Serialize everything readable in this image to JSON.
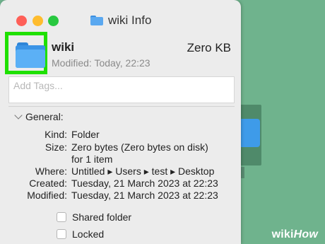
{
  "window": {
    "title": "wiki Info"
  },
  "header": {
    "name": "wiki",
    "size": "Zero KB",
    "modified": "Modified: Today, 22:23"
  },
  "tags": {
    "placeholder": "Add Tags..."
  },
  "general": {
    "heading": "General:",
    "rows": [
      {
        "label": "Kind:",
        "value": "Folder"
      },
      {
        "label": "Size:",
        "value": "Zero bytes (Zero bytes on disk)"
      },
      {
        "label": "",
        "value": "for 1 item"
      },
      {
        "label": "Where:",
        "value": "Untitled ▸ Users ▸ test ▸ Desktop"
      },
      {
        "label": "Created:",
        "value": "Tuesday, 21 March 2023 at 22:23"
      },
      {
        "label": "Modified:",
        "value": "Tuesday, 21 March 2023 at 22:23"
      }
    ],
    "checkboxes": [
      {
        "label": "Shared folder",
        "checked": false
      },
      {
        "label": "Locked",
        "checked": false
      }
    ]
  },
  "watermark": {
    "part1": "wiki",
    "part2": "How"
  },
  "colors": {
    "highlight": "#1fe000",
    "desktop": "#6fb38d",
    "folder": "#3b94e6"
  }
}
